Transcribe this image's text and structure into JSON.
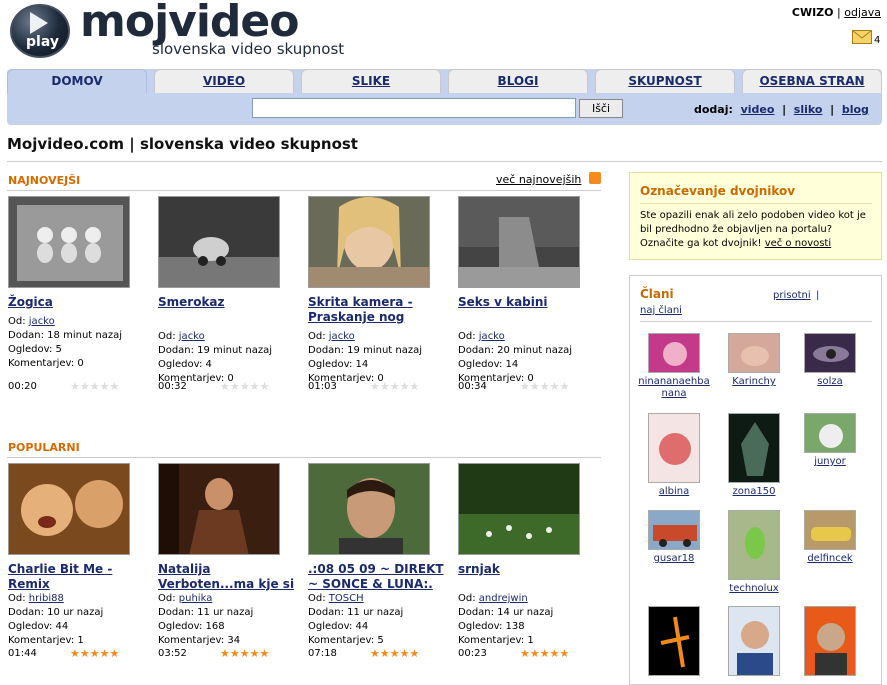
{
  "brand": {
    "logo_text": "mojvideo",
    "play_text": "play",
    "tagline": "slovenska video skupnost"
  },
  "user": {
    "name": "CWIZO",
    "sep": "|",
    "logout": "odjava",
    "mail_count": "4"
  },
  "nav": {
    "tabs": [
      "DOMOV",
      "VIDEO",
      "SLIKE",
      "BLOGI",
      "SKUPNOST",
      "OSEBNA STRAN"
    ],
    "search_btn": "Išči",
    "search_value": "",
    "add_label": "dodaj:",
    "add_links": [
      "video",
      "sliko",
      "blog"
    ],
    "sep": "|"
  },
  "page_title": "Mojvideo.com | slovenska video skupnost",
  "newest": {
    "heading": "NAJNOVEJŠI",
    "more": "več najnovejših",
    "items": [
      {
        "title": "Žogica",
        "by_label": "Od:",
        "by": "jacko",
        "added": "Dodan: 18 minut nazaj",
        "views": "Ogledov: 5",
        "comments": "Komentarjev: 0",
        "dur": "00:20",
        "rating": 0
      },
      {
        "title": "Smerokaz",
        "by_label": "Od:",
        "by": "jacko",
        "added": "Dodan: 19 minut nazaj",
        "views": "Ogledov: 4",
        "comments": "Komentarjev: 0",
        "dur": "00:32",
        "rating": 0
      },
      {
        "title": "Skrita kamera - Praskanje nog",
        "by_label": "Od:",
        "by": "jacko",
        "added": "Dodan: 19 minut nazaj",
        "views": "Ogledov: 14",
        "comments": "Komentarjev: 0",
        "dur": "01:03",
        "rating": 0
      },
      {
        "title": "Seks v kabini",
        "by_label": "Od:",
        "by": "jacko",
        "added": "Dodan: 20 minut nazaj",
        "views": "Ogledov: 14",
        "comments": "Komentarjev: 0",
        "dur": "00:34",
        "rating": 0
      }
    ]
  },
  "popular": {
    "heading": "POPULARNI",
    "items": [
      {
        "title": "Charlie Bit Me - Remix",
        "by_label": "Od:",
        "by": "hribi88",
        "added": "Dodan: 10 ur nazaj",
        "views": "Ogledov: 44",
        "comments": "Komentarjev: 1",
        "dur": "01:44",
        "rating": 5
      },
      {
        "title": "Natalija Verboten...ma kje si",
        "by_label": "Od:",
        "by": "puhika",
        "added": "Dodan: 11 ur nazaj",
        "views": "Ogledov: 168",
        "comments": "Komentarjev: 34",
        "dur": "03:52",
        "rating": 5
      },
      {
        "title": ".:08 05 09 ~ DIREKT ~ SONCE & LUNA:.",
        "by_label": "Od:",
        "by": "TOSCH",
        "added": "Dodan: 11 ur nazaj",
        "views": "Ogledov: 44",
        "comments": "Komentarjev: 5",
        "dur": "07:18",
        "rating": 5
      },
      {
        "title": "srnjak",
        "by_label": "Od:",
        "by": "andrejwin",
        "added": "Dodan: 14 ur nazaj",
        "views": "Ogledov: 138",
        "comments": "Komentarjev: 1",
        "dur": "00:23",
        "rating": 5
      }
    ]
  },
  "dup": {
    "title": "Označevanje dvojnikov",
    "text": "Ste opazili enak ali zelo podoben video kot je bil predhodno že objavljen na portalu? Označite ga kot dvojnik!",
    "link": "več o novosti"
  },
  "members": {
    "title": "Člani",
    "present": "prisotni",
    "sep": "|",
    "top": "naj člani",
    "items": [
      "ninananaehbanana",
      "Karinchy",
      "solza",
      "albina",
      "zona150",
      "junyor",
      "gusar18",
      "technolux",
      "delfincek"
    ]
  },
  "colors": {
    "accent": "#d56b00",
    "nav_bg": "#c5d2ee",
    "link": "#1a2a6a",
    "star_on": "#f18a18",
    "star_off": "#dddddd"
  }
}
